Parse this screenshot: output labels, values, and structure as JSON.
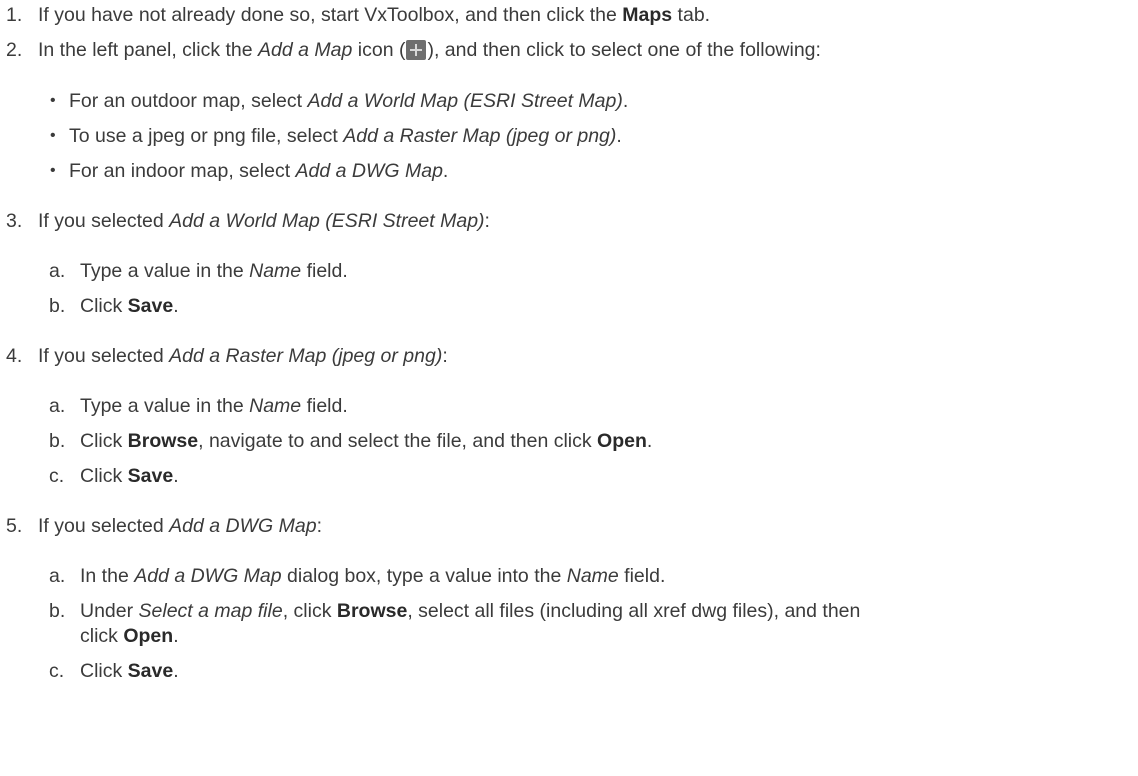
{
  "steps": [
    {
      "num": "1.",
      "parts": [
        "If you have not already done so, start VxToolbox, and then click the ",
        "Maps",
        " tab."
      ]
    },
    {
      "num": "2.",
      "parts": [
        "In the left panel, click the ",
        "Add a Map",
        " icon (",
        "), and then click to select one of the following:"
      ],
      "icon": "plus-icon",
      "bullets": [
        {
          "parts": [
            "For an outdoor map, select ",
            "Add a World Map (ESRI Street Map)",
            "."
          ]
        },
        {
          "parts": [
            "To use a jpeg or png file, select ",
            "Add a Raster Map (jpeg or png)",
            "."
          ]
        },
        {
          "parts": [
            "For an indoor map, select ",
            "Add a DWG Map",
            "."
          ]
        }
      ]
    },
    {
      "num": "3.",
      "parts": [
        "If you selected ",
        "Add a World Map (ESRI Street Map)",
        ":"
      ],
      "subs": [
        {
          "label": "a.",
          "parts": [
            "Type a value in the ",
            "Name",
            " field."
          ]
        },
        {
          "label": "b.",
          "parts": [
            "Click ",
            "Save",
            "."
          ]
        }
      ]
    },
    {
      "num": "4.",
      "parts": [
        "If you selected ",
        "Add a Raster Map (jpeg or png)",
        ":"
      ],
      "subs": [
        {
          "label": "a.",
          "parts": [
            "Type a value in the ",
            "Name",
            " field."
          ]
        },
        {
          "label": "b.",
          "parts": [
            "Click ",
            "Browse",
            ", navigate to and select the file, and then click ",
            "Open",
            "."
          ]
        },
        {
          "label": "c.",
          "parts": [
            "Click ",
            "Save",
            "."
          ]
        }
      ]
    },
    {
      "num": "5.",
      "parts": [
        "If you selected ",
        "Add a DWG Map",
        ":"
      ],
      "subs": [
        {
          "label": "a.",
          "parts": [
            "In the ",
            "Add a DWG Map",
            " dialog box, type a value into the ",
            "Name",
            " field."
          ]
        },
        {
          "label": "b.",
          "parts": [
            "Under ",
            "Select a map file",
            ", click ",
            "Browse",
            ", select all files (including all xref dwg files), and then",
            "click ",
            "Open",
            "."
          ]
        },
        {
          "label": "c.",
          "parts": [
            "Click ",
            "Save",
            "."
          ]
        }
      ]
    }
  ]
}
